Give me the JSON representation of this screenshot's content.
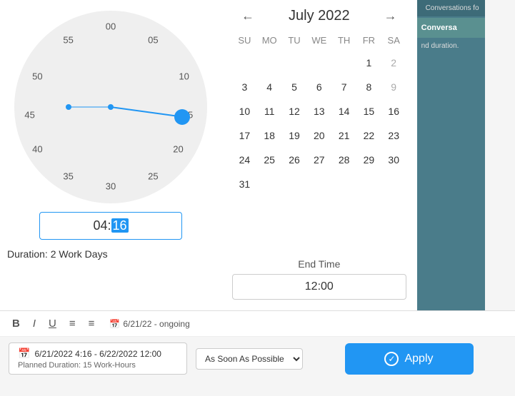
{
  "header": {
    "prev_label": "←",
    "next_label": "→",
    "month_title": "July 2022"
  },
  "calendar": {
    "weekdays": [
      "SU",
      "MO",
      "TU",
      "WE",
      "TH",
      "FR",
      "SA"
    ],
    "weeks": [
      [
        "",
        "",
        "",
        "",
        "",
        "1",
        "2"
      ],
      [
        "3",
        "4",
        "5",
        "6",
        "7",
        "8",
        "9"
      ],
      [
        "10",
        "11",
        "12",
        "13",
        "14",
        "15",
        "16"
      ],
      [
        "17",
        "18",
        "19",
        "20",
        "21",
        "22",
        "23"
      ],
      [
        "24",
        "25",
        "26",
        "27",
        "28",
        "29",
        "30"
      ],
      [
        "31",
        "",
        "",
        "",
        "",
        "",
        ""
      ]
    ]
  },
  "end_time": {
    "label": "End Time",
    "value": "12:00"
  },
  "clock": {
    "time_value": "04:",
    "time_highlight": "16",
    "labels": {
      "top": "00",
      "top_right1": "05",
      "right1": "10",
      "right2": "15",
      "right3": "20",
      "bottom_right": "25",
      "bottom": "30",
      "bottom_left": "35",
      "left1": "40",
      "left2": "45",
      "left3": "50",
      "top_left": "55"
    }
  },
  "duration": {
    "label": "Duration: 2 Work Days"
  },
  "bottom": {
    "date_badge": "6/21/22 - ongoing",
    "calendar_icon": "📅",
    "date_range_title": "6/21/2022 4:16 - 6/22/2022 12:00",
    "planned_duration": "Planned Duration: 15 Work-Hours",
    "as_soon_label": "As Soon As Possible",
    "apply_label": "Apply"
  },
  "toolbar": {
    "bold_label": "B",
    "italic_label": "I",
    "underline_label": "U",
    "list1_label": "≡",
    "list2_label": "≡"
  },
  "side_panel": {
    "conversations_label": "Conversations fo",
    "convo_title": "Conversa",
    "duration_text": "nd duration."
  },
  "colors": {
    "primary": "#2196F3",
    "teal": "#4a7c8a",
    "dark_teal": "#3d6b78"
  }
}
